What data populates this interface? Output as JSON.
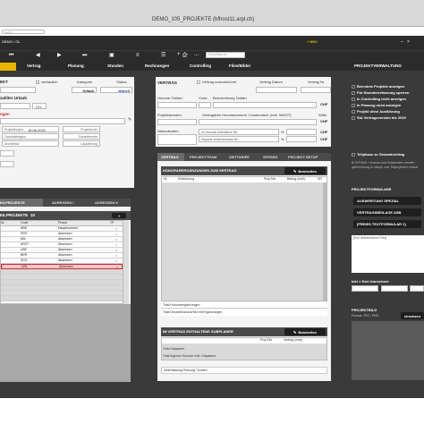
{
  "window": {
    "title": "DEMO_105_PROJEKTE (bfhost11.arpl.ch)",
    "search_placeholder": "Suche",
    "user_label": "DEMO / GL",
    "new_label": "+ NEU",
    "record_search_placeholder": "Schnellsuche"
  },
  "toolbar": {
    "plus": "+",
    "minus": "-",
    "ellipsis": "..."
  },
  "nav_tabs": [
    {
      "label": ""
    },
    {
      "label": "Vertrag"
    },
    {
      "label": "Planung"
    },
    {
      "label": "Stunden"
    },
    {
      "label": "Rechnungen"
    },
    {
      "label": "Controlling"
    },
    {
      "label": "Files/Bilder"
    }
  ],
  "nav_right": "PROJEKTVERWALTUNG",
  "left": {
    "section_title": "EKT",
    "vertraulich": "vertraulich",
    "kategorie": "Kategorie",
    "status": "Status",
    "ueber_label": "zahlter Urlaub",
    "urlaub": "Urlaub",
    "aktuell": "aktuell",
    "ch": "CH",
    "section2": "ngen",
    "projektbeginn_label": "Projektbeginn",
    "projektbeginn_value": "15.06.2021",
    "projektende": "Projektende",
    "garantiebeginn": "Garantiebeginn",
    "garantieende": "Garantieende",
    "architektur": "Architektur",
    "liquidierung": "Liquidierung",
    "sub_tabs": [
      "EILPROJEKTE",
      "ADRESSEN I",
      "ADRESSEN II"
    ],
    "list_title": "EILPROJEKTE",
    "list_count": "10",
    "columns": [
      "Nr",
      "Code",
      "Phase",
      "TP"
    ],
    "rows": [
      {
        "nr": "",
        "code": "ABS",
        "phase": "Hauptnummer",
        "sel": false
      },
      {
        "nr": "",
        "code": "FER",
        "phase": "Absenzen",
        "sel": false
      },
      {
        "nr": "",
        "code": "MIL",
        "phase": "Absenzen",
        "sel": false
      },
      {
        "nr": "",
        "code": "ARZT",
        "phase": "Absenzen",
        "sel": false
      },
      {
        "nr": "",
        "code": "UNF",
        "phase": "Absenzen",
        "sel": false
      },
      {
        "nr": "",
        "code": "BER",
        "phase": "Absenzen",
        "sel": false
      },
      {
        "nr": "",
        "code": "SCH",
        "phase": "Absenzen",
        "sel": false
      },
      {
        "nr": "7",
        "code": "URL",
        "phase": "Absenzen",
        "sel": true
      }
    ],
    "add_button": "+"
  },
  "middle": {
    "vertrag_title": "VERTRAG",
    "vertrag_unterzeichnet": "Vertrag unterzeichnet",
    "vertrag_datum": "Vertrag Datum",
    "vertrag_nr": "Vertrag Nr",
    "honorar_tarifart": "Honorar Tarifart",
    "code": "Code",
    "beschreibung_tarifart": "Beschreibung Tarifart",
    "chf": "CHF",
    "projektstunden": "Projektstunden",
    "vertragliche_honorarsumme": "Vertragliche Honorarsumme / Kostendach (exkl. MWST)",
    "waehr": "Währ",
    "nebenkosten": "Nebenkosten",
    "im_honorar_nk": "im Honorar enthaltene NK",
    "separat_nk": "Separat verrechenbare NK",
    "percent": "%",
    "tabs": [
      "VERTRAG",
      "PROJEKTTEAM",
      "ZEITTARIFE",
      "SPESEN",
      "PROJEKT-SETUP"
    ],
    "honorar_title": "HONORARERGÄNZUNGEN ZUM VERTRAG",
    "bearbeiten": "Bearbeiten",
    "honorar_columns": [
      "Nr",
      "Erläuterung",
      "Proj-Std",
      "Betrag (exkl)",
      "SR"
    ],
    "total_honorar": "Total Honorarergänzungen",
    "total_gesamt": "Total Gesamthonorar/Std mit Ergänzungen",
    "sub_title": "IM VERTRAG ENTHALTENE SUBPLANER",
    "sub_columns": [
      "Proj-Std",
      "Vertrag (exkl)"
    ],
    "total_subplaner": "Total Subplaner",
    "total_eigenes": "Total eigenes Honorar exkl. Subplaner",
    "zielerfassung": "Zielerfassung Planung / Kosten"
  },
  "right": {
    "checkboxes": [
      "Beendete Projekte anzeigen",
      "Für Stundenerfassung sperren",
      "In Controlling nicht anzeigen",
      "In Planung nicht anzeigen",
      "Projekt ohne Ausführung",
      "SIA Vertragsversion bis 2019"
    ],
    "teilphase": "Teilphase zu Gesamtvertrag",
    "note": "ACHTUNG: Honorar und Sollstunden werden gleichmässig in Haupt- und Teilprojekten erfasst.",
    "formulare_title": "PROJEKTFORMULARE",
    "btn_auswertung": "AUSWERTUNG SPEZIAL",
    "btn_vertragsbeilage": "VERTRAGSBEILAGE ASB",
    "btn_freies": "[FREIES TEXTFORMULAR 1]",
    "frei_label": "[Frei definierbares Feld]",
    "inkl_exkl": "Inkl > Exkl Umrechner",
    "projektbild": "PROJEKTBILD",
    "format": "Format: JPG / PNG",
    "einsetzen": "einsetzen"
  },
  "colors": {
    "dark_bg": "#3a3a3a",
    "header_bg": "#2b2b2b",
    "accent": "#e8b400",
    "panel": "#f4f4f4",
    "tab_active": "#6b6b6b",
    "selection_red": "#d12a2a"
  }
}
